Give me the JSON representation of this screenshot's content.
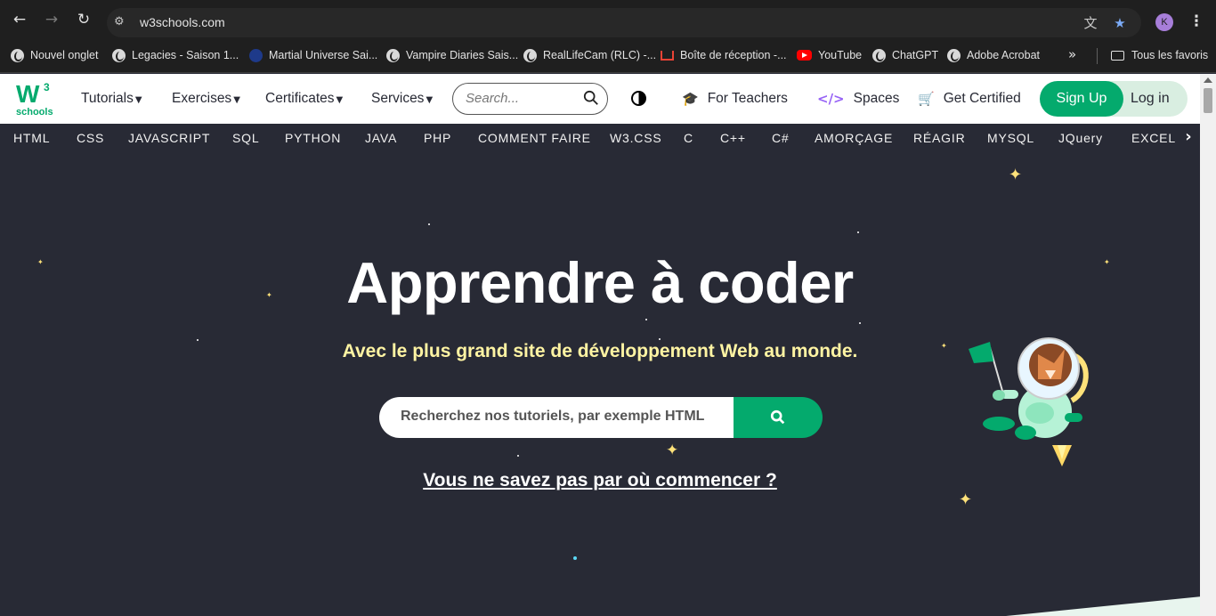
{
  "browser": {
    "url": "w3schools.com",
    "profile_initial": "K",
    "bookmarks": [
      {
        "label": "Nouvel onglet",
        "icon": "globe-icon"
      },
      {
        "label": "Legacies - Saison 1...",
        "icon": "globe-icon"
      },
      {
        "label": "Martial Universe Sai...",
        "icon": "site-icon"
      },
      {
        "label": "Vampire Diaries Sais...",
        "icon": "globe-icon"
      },
      {
        "label": "RealLifeCam (RLC) -...",
        "icon": "globe-icon"
      },
      {
        "label": "Boîte de réception -...",
        "icon": "gmail-icon"
      },
      {
        "label": "YouTube",
        "icon": "youtube-icon"
      },
      {
        "label": "ChatGPT",
        "icon": "chatgpt-icon"
      },
      {
        "label": "Adobe Acrobat",
        "icon": "globe-icon"
      }
    ],
    "all_bookmarks_label": "Tous les favoris"
  },
  "topnav": {
    "logo_letter": "W",
    "logo_sup": "3",
    "logo_sub": "schools",
    "tutorials": "Tutorials",
    "exercises": "Exercises",
    "certificates": "Certificates",
    "services": "Services",
    "search_placeholder": "Search...",
    "for_teachers": "For Teachers",
    "spaces": "Spaces",
    "get_certified": "Get Certified",
    "sign_up": "Sign Up",
    "log_in": "Log in"
  },
  "subjects": [
    "HTML",
    "CSS",
    "JAVASCRIPT",
    "SQL",
    "PYTHON",
    "JAVA",
    "PHP",
    "COMMENT FAIRE",
    "W3.CSS",
    "C",
    "C++",
    "C#",
    "AMORÇAGE",
    "RÉAGIR",
    "MYSQL",
    "JQuery",
    "EXCEL"
  ],
  "hero": {
    "title": "Apprendre à coder",
    "subtitle": "Avec le plus grand site de développement Web au monde.",
    "search_placeholder": "Recherchez nos tutoriels, par exemple HTML",
    "link": "Vous ne savez pas par où commencer ?"
  },
  "colors": {
    "brand_green": "#04aa6d",
    "hero_bg": "#282a35",
    "subtitle_yellow": "#fff4a3",
    "accent_purple": "#9763f6"
  }
}
